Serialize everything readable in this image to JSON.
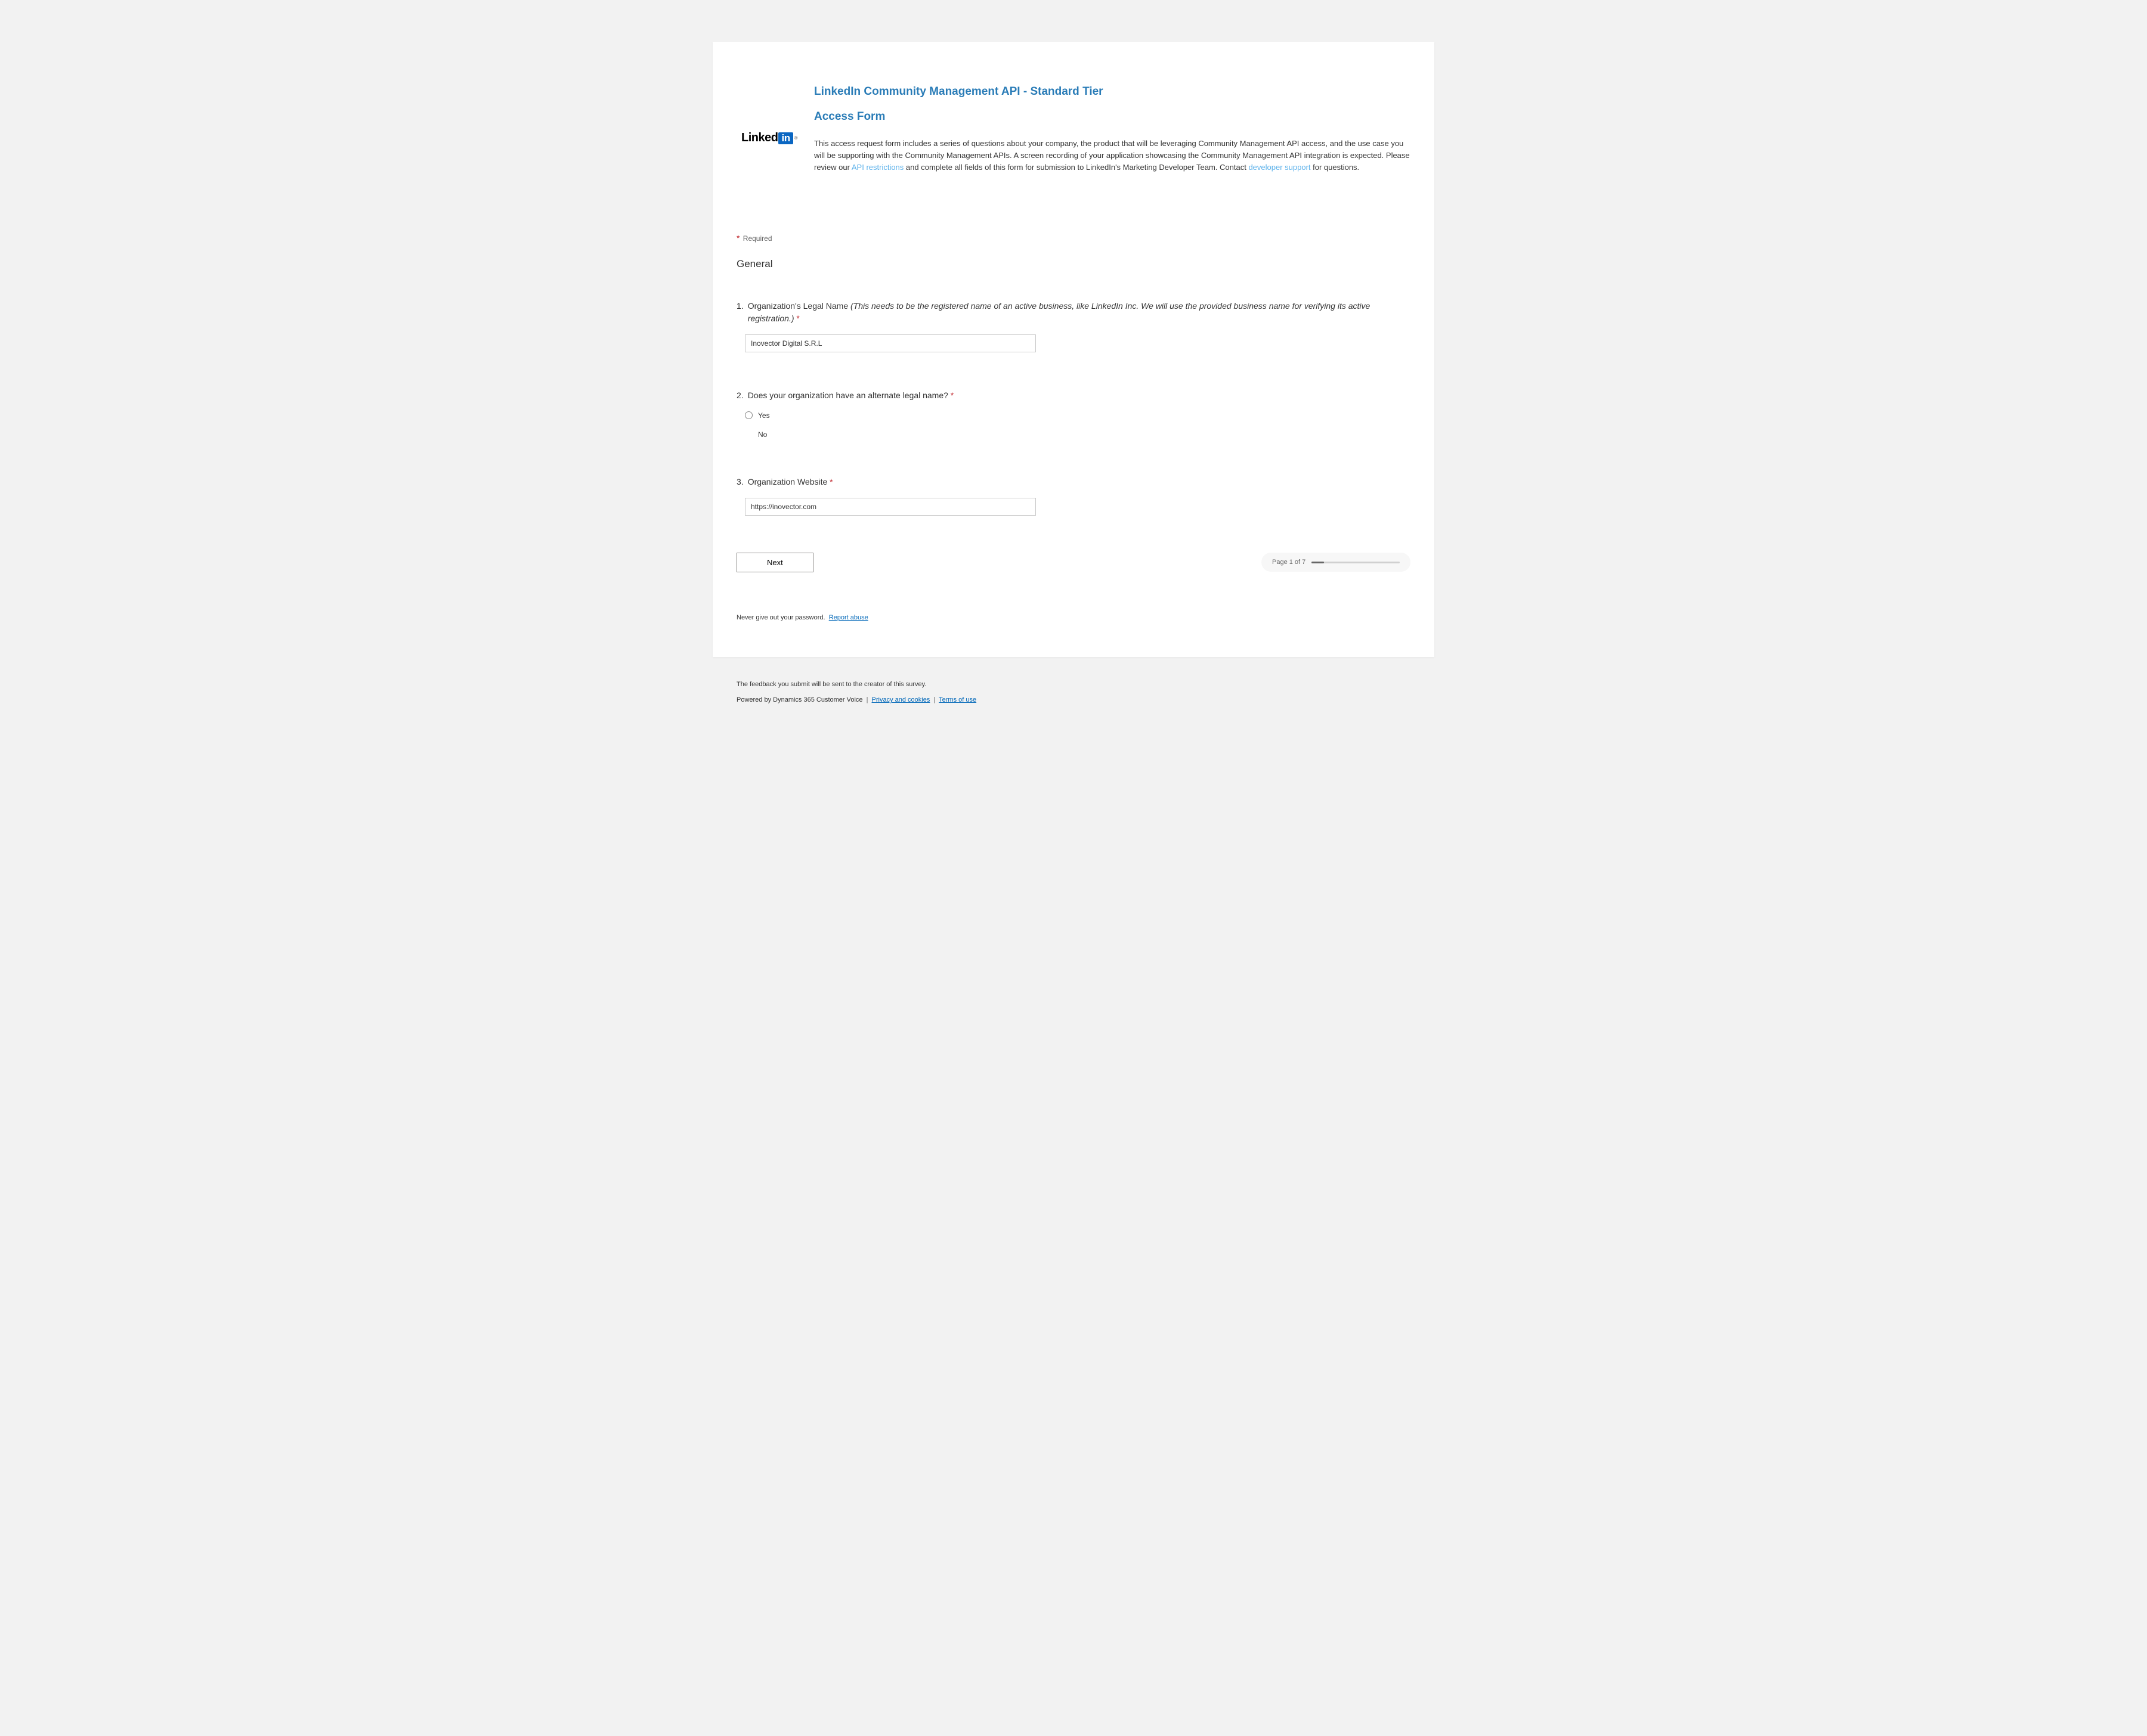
{
  "header": {
    "logo_text": "Linked",
    "logo_in": "in",
    "logo_reg": "®",
    "title": "LinkedIn Community Management API - Standard Tier",
    "subtitle": "Access Form",
    "intro_part1": "This access request form includes a series of questions about your company, the product that will be leveraging Community Management API access, and the use case you will be supporting with the Community Management APIs. A screen recording of your application showcasing the Community Management API integration is expected. Please review our ",
    "intro_link1": "API restrictions",
    "intro_part2": " and complete all fields of this form for submission to LinkedIn's Marketing Developer Team. Contact ",
    "intro_link2": "developer support",
    "intro_part3": " for questions."
  },
  "required_label": "Required",
  "section_title": "General",
  "questions": {
    "q1": {
      "num": "1.",
      "label": "Organization's Legal Name ",
      "hint": "(This needs to be the registered name of an active business, like LinkedIn Inc. We will use the provided business name for verifying its active registration.)",
      "star": " *",
      "value": "Inovector Digital S.R.L"
    },
    "q2": {
      "num": "2.",
      "label": "Does your organization have an alternate legal name? ",
      "star": "*",
      "opt_yes": "Yes",
      "opt_no": "No"
    },
    "q3": {
      "num": "3.",
      "label": "Organization Website ",
      "star": "*",
      "value": "https://inovector.com"
    }
  },
  "nav": {
    "next_label": "Next",
    "page_label": "Page 1 of 7",
    "progress_pct": 14
  },
  "password_note": "Never give out your password.",
  "report_abuse": "Report abuse",
  "footer": {
    "line1": "The feedback you submit will be sent to the creator of this survey.",
    "powered": "Powered by Dynamics 365 Customer Voice ",
    "sep": "|",
    "privacy": "Privacy and cookies",
    "terms": "Terms of use"
  }
}
